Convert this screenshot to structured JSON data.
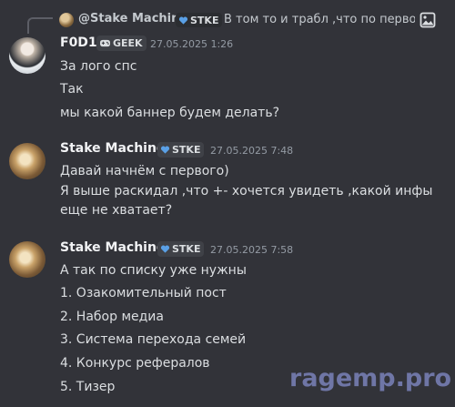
{
  "reply": {
    "author": "@Stake Machine",
    "tag": "STKE",
    "tag_icon": "heart-shield-icon",
    "text": "В том то и трабл ,что по первому ...",
    "attachment_icon": "image-icon"
  },
  "messages": [
    {
      "author": "F0D1",
      "tag": "GEEK",
      "tag_icon": "gamepad-icon",
      "time": "27.05.2025 1:26",
      "lines": [
        "За лого спс",
        "Так",
        "мы какой баннер будем делать?"
      ]
    },
    {
      "author": "Stake Machine",
      "tag": "STKE",
      "tag_icon": "heart-shield-icon",
      "time": "27.05.2025 7:48",
      "lines": [
        "Давай начнём с первого)",
        "Я выше раскидал ,что +- хочется увидеть ,какой инфы",
        "еще не хватает?"
      ]
    },
    {
      "author": "Stake Machine",
      "tag": "STKE",
      "tag_icon": "heart-shield-icon",
      "time": "27.05.2025 7:58",
      "lines": [
        "А так по списку уже нужны",
        "1. Озакомительный пост",
        "2. Набор медиа",
        "3. Система перехода семей",
        "4. Конкурс рефералов",
        "5. Тизер"
      ]
    }
  ],
  "watermark": "ragemp.pro",
  "colors": {
    "background": "#323339",
    "tag_heart": "#5aa0e6",
    "watermark": "#6f76a6"
  }
}
